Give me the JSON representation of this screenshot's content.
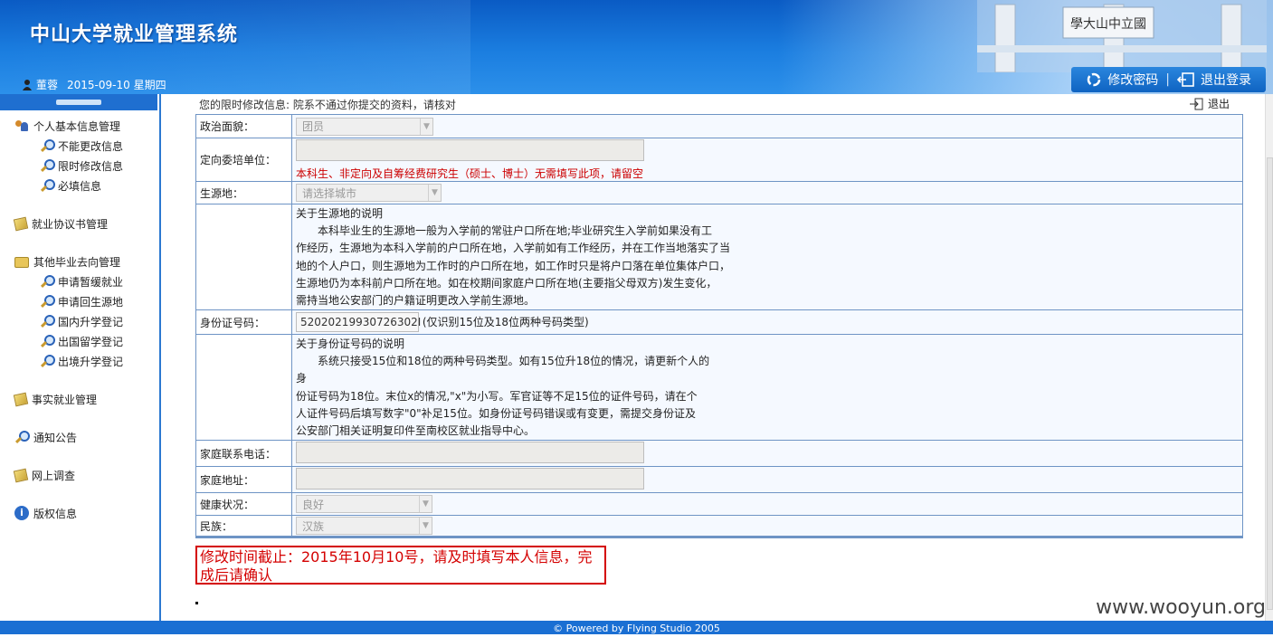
{
  "header": {
    "title": "中山大学就业管理系统",
    "user": "董蓉",
    "date": "2015-09-10 星期四",
    "change_password": "修改密码",
    "logout": "退出登录",
    "gate_text": "學大山中立國"
  },
  "sidebar": {
    "groups": [
      {
        "title": "个人基本信息管理",
        "icon": "people-icon",
        "items": [
          "不能更改信息",
          "限时修改信息",
          "必填信息"
        ]
      },
      {
        "title": "就业协议书管理",
        "icon": "document-icon",
        "items": []
      },
      {
        "title": "其他毕业去向管理",
        "icon": "folder-icon",
        "items": [
          "申请暂缓就业",
          "申请回生源地",
          "国内升学登记",
          "出国留学登记",
          "出境升学登记"
        ]
      },
      {
        "title": "事实就业管理",
        "icon": "document-icon",
        "items": []
      },
      {
        "title": "通知公告",
        "icon": "search-icon",
        "items": []
      },
      {
        "title": "网上调查",
        "icon": "document-icon",
        "items": []
      },
      {
        "title": "版权信息",
        "icon": "info-icon",
        "items": []
      }
    ]
  },
  "main": {
    "tip": "您的限时修改信息: 院系不通过你提交的资料，请核对",
    "exit": "退出",
    "form": {
      "political": {
        "label": "政治面貌：",
        "value": "团员"
      },
      "directed_unit": {
        "label": "定向委培单位：",
        "value": "",
        "note": "本科生、非定向及自筹经费研究生（硕士、博士）无需填写此项，请留空"
      },
      "origin": {
        "label": "生源地：",
        "placeholder": "请选择城市"
      },
      "origin_expl": {
        "title": "关于生源地的说明",
        "lines": [
          "本科毕业生的生源地一般为入学前的常驻户口所在地;毕业研究生入学前如果没有工",
          "作经历，生源地为本科入学前的户口所在地，入学前如有工作经历，并在工作当地落实了当",
          "地的个人户口，则生源地为工作时的户口所在地，如工作时只是将户口落在单位集体户口，",
          "生源地仍为本科前户口所在地。如在校期间家庭户口所在地(主要指父母双方)发生变化，",
          "需持当地公安部门的户籍证明更改入学前生源地。"
        ]
      },
      "id_number": {
        "label": "身份证号码：",
        "value": "52020219930726302I",
        "hint": "(仅识别15位及18位两种号码类型)"
      },
      "id_expl": {
        "title": "关于身份证号码的说明",
        "lines": [
          "系统只接受15位和18位的两种号码类型。如有15位升18位的情况，请更新个人的身",
          "份证号码为18位。末位x的情况,\"x\"为小写。军官证等不足15位的证件号码，请在个",
          "人证件号码后填写数字\"0\"补足15位。如身份证号码错误或有变更，需提交身份证及",
          "公安部门相关证明复印件至南校区就业指导中心。"
        ]
      },
      "home_phone": {
        "label": "家庭联系电话：",
        "value": ""
      },
      "home_address": {
        "label": "家庭地址：",
        "value": ""
      },
      "health": {
        "label": "健康状况：",
        "value": "良好"
      },
      "ethnicity": {
        "label": "民族：",
        "value": "汉族"
      }
    },
    "deadline": "修改时间截止：2015年10月10号，请及时填写本人信息，完成后请确认"
  },
  "watermark": "www.wooyun.org",
  "footer": "© Powered by   Flying Studio  2005"
}
